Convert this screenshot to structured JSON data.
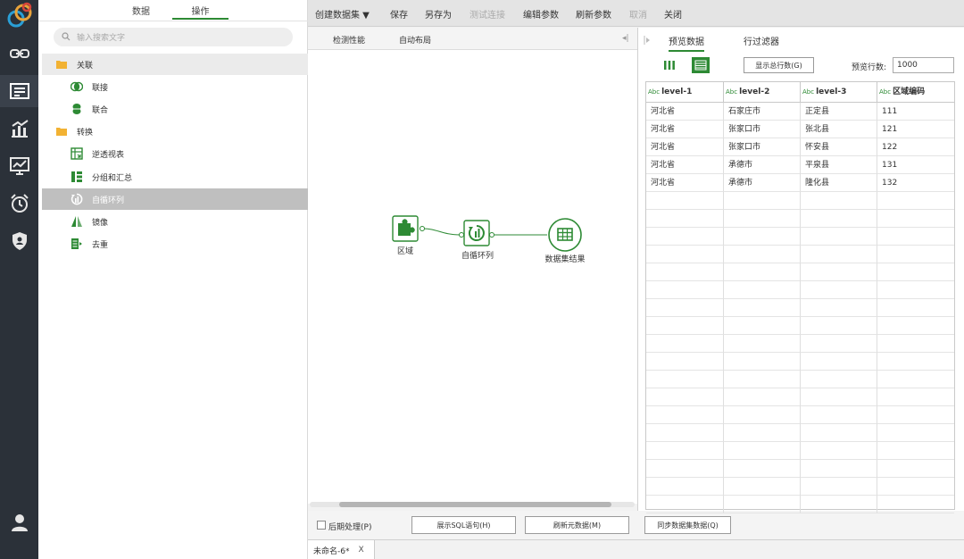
{
  "operator_panel": {
    "tabs": [
      "数据",
      "操作"
    ],
    "active_tab": "操作",
    "search_placeholder": "输入搜索文字",
    "tree": [
      {
        "label": "关联",
        "icon": "folder-icon",
        "type": "group"
      },
      {
        "label": "联接",
        "icon": "join-icon",
        "type": "item"
      },
      {
        "label": "联合",
        "icon": "union-icon",
        "type": "item"
      },
      {
        "label": "转换",
        "icon": "folder-icon",
        "type": "group"
      },
      {
        "label": "逆透视表",
        "icon": "unpivot-icon",
        "type": "item"
      },
      {
        "label": "分组和汇总",
        "icon": "group-summary-icon",
        "type": "item"
      },
      {
        "label": "自循环列",
        "icon": "self-loop-icon",
        "type": "item",
        "selected": true
      },
      {
        "label": "镜像",
        "icon": "mirror-icon",
        "type": "item"
      },
      {
        "label": "去重",
        "icon": "dedupe-icon",
        "type": "item"
      }
    ]
  },
  "toolbar": {
    "create_dataset": "创建数据集 ▼",
    "save": "保存",
    "save_as": "另存为",
    "test_connection": "测试连接",
    "edit_params": "编辑参数",
    "refresh_params": "刷新参数",
    "cancel": "取消",
    "close": "关闭"
  },
  "canvas": {
    "head_buttons": [
      "检测性能",
      "自动布局"
    ],
    "nodes": [
      {
        "label": "区域",
        "icon": "puzzle-icon"
      },
      {
        "label": "自循环列",
        "icon": "self-loop-icon"
      },
      {
        "label": "数据集结果",
        "icon": "table-result-icon"
      }
    ]
  },
  "actions": {
    "post_process": "后期处理(P)",
    "show_sql": "展示SQL语句(H)",
    "refresh_meta": "刷新元数据(M)",
    "sync_data": "同步数据集数据(Q)"
  },
  "file_tab": {
    "label": "未命名-6*",
    "close": "X"
  },
  "preview": {
    "tabs": [
      "预览数据",
      "行过滤器"
    ],
    "show_total": "显示总行数(G)",
    "rows_label": "预览行数:",
    "rows_value": "1000",
    "type_tag": "Abc",
    "columns": [
      "level-1",
      "level-2",
      "level-3",
      "区域编码"
    ],
    "rows": [
      [
        "河北省",
        "石家庄市",
        "正定县",
        "111"
      ],
      [
        "河北省",
        "张家口市",
        "张北县",
        "121"
      ],
      [
        "河北省",
        "张家口市",
        "怀安县",
        "122"
      ],
      [
        "河北省",
        "承德市",
        "平泉县",
        "131"
      ],
      [
        "河北省",
        "承德市",
        "隆化县",
        "132"
      ]
    ]
  },
  "colors": {
    "accent": "#2d8a34",
    "rail": "#2b3139"
  }
}
